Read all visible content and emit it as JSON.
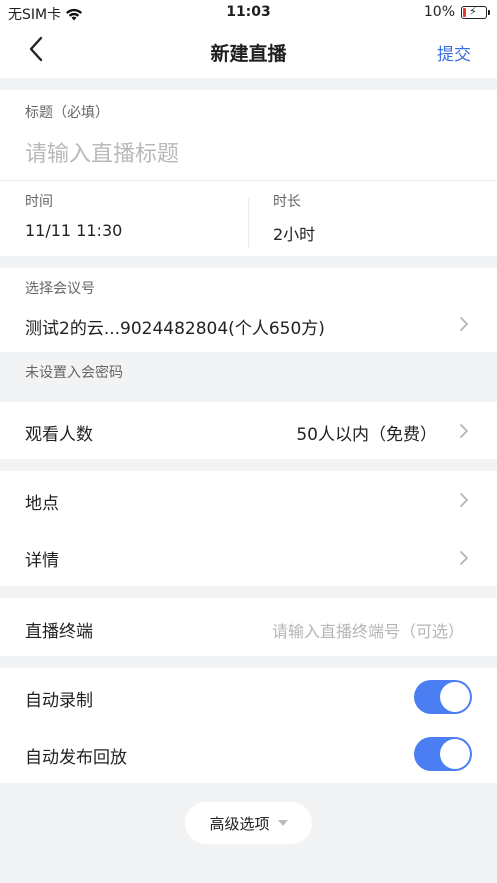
{
  "status_bar": {
    "carrier": "无SIM卡",
    "time": "11:03",
    "battery": "10%"
  },
  "nav": {
    "title": "新建直播",
    "submit": "提交"
  },
  "title_field": {
    "label": "标题（必填）",
    "placeholder": "请输入直播标题"
  },
  "time": {
    "label": "时间",
    "value": "11/11 11:30"
  },
  "duration": {
    "label": "时长",
    "value": "2小时"
  },
  "meeting": {
    "label": "选择会议号",
    "value": "测试2的云...9024482804(个人650方)",
    "hint": "未设置入会密码"
  },
  "viewers": {
    "label": "观看人数",
    "value": "50人以内（免费）"
  },
  "location": {
    "label": "地点"
  },
  "details": {
    "label": "详情"
  },
  "terminal": {
    "label": "直播终端",
    "placeholder": "请输入直播终端号（可选）"
  },
  "auto_record": {
    "label": "自动录制",
    "enabled": true
  },
  "auto_publish": {
    "label": "自动发布回放",
    "enabled": true
  },
  "advanced": {
    "label": "高级选项"
  }
}
